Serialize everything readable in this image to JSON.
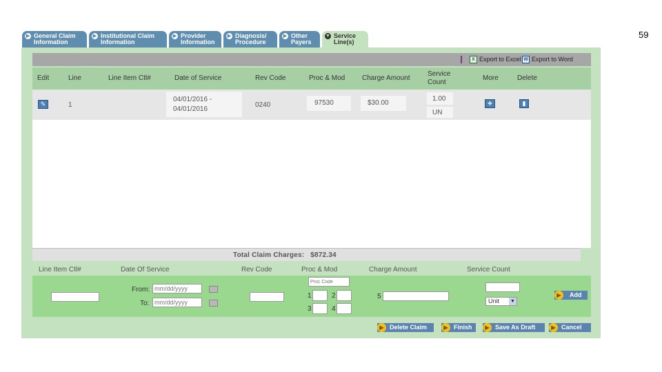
{
  "page_number": "59",
  "tabs": [
    {
      "label": "General Claim\nInformation",
      "icon": "arrow-circle-icon"
    },
    {
      "label": "Institutional Claim\nInformation",
      "icon": "arrow-circle-icon"
    },
    {
      "label": "Provider\nInformation",
      "icon": "arrow-circle-icon"
    },
    {
      "label": "Diagnosis/\nProcedure",
      "icon": "arrow-circle-icon"
    },
    {
      "label": "Other\nPayers",
      "icon": "arrow-circle-icon"
    },
    {
      "label": "Service\nLine(s)",
      "icon": "down-circle-icon",
      "active": true
    }
  ],
  "toolbar": {
    "export_excel": "Export to Excel",
    "export_word": "Export to Word"
  },
  "columns": {
    "edit": "Edit",
    "line": "Line",
    "line_item_ctl": "Line Item Ctl#",
    "date_of_service": "Date of Service",
    "rev_code": "Rev Code",
    "proc_mod": "Proc & Mod",
    "charge_amount": "Charge Amount",
    "service_count": "Service\nCount",
    "more": "More",
    "delete": "Delete"
  },
  "rows": [
    {
      "line": "1",
      "line_item_ctl": "",
      "date_of_service": "04/01/2016 -\n04/01/2016",
      "rev_code": "0240",
      "proc_mod": "97530",
      "charge_amount": "$30.00",
      "service_count": "1.00",
      "unit": "UN"
    }
  ],
  "total": {
    "label": "Total Claim Charges:",
    "value": "$872.34"
  },
  "form": {
    "headers": {
      "line_item_ctl": "Line Item Ctl#",
      "date_of_service": "Date Of Service",
      "rev_code": "Rev Code",
      "proc_mod": "Proc & Mod",
      "charge_amount": "Charge Amount",
      "service_count": "Service Count"
    },
    "from_label": "From:",
    "to_label": "To:",
    "date_placeholder": "mm/dd/yyyy",
    "proc_code_placeholder": "Proc Code",
    "mod_labels": [
      "1",
      "2",
      "3",
      "4"
    ],
    "charge_index": "5",
    "unit_selected": "Unit",
    "add_label": "Add"
  },
  "footer": {
    "delete_claim": "Delete Claim",
    "finish": "Finish",
    "save_as_draft": "Save As Draft",
    "cancel": "Cancel"
  },
  "colors": {
    "tab_blue": "#5f8db0",
    "panel_green": "#c5e2c0",
    "header_green": "#a7cfa4",
    "form_green": "#9ad88f",
    "button_blue": "#5b83b0",
    "button_orange": "#f0c020"
  }
}
